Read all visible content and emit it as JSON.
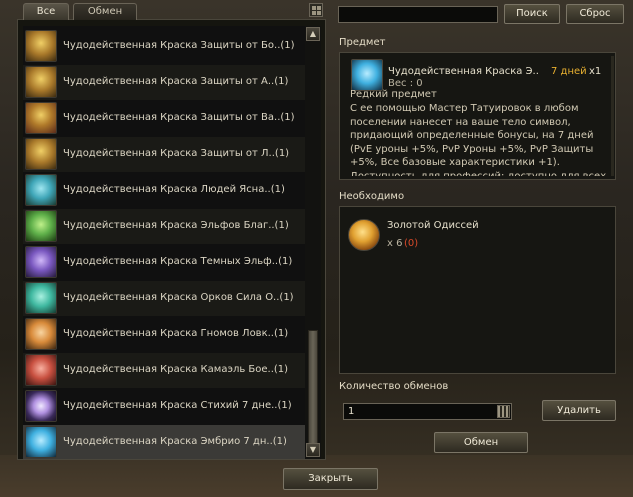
{
  "tabs": [
    {
      "label": "Все",
      "active": true
    },
    {
      "label": "Обмен",
      "active": false
    }
  ],
  "list": {
    "items": [
      {
        "label": "Чудодейственная Краска Защиты от Бо..(1)",
        "icon": "gold-dye-bottle-icon",
        "color": "#d8a43a"
      },
      {
        "label": "Чудодейственная Краска Защиты от А..(1)",
        "icon": "gold-dye-bottle-icon",
        "color": "#d8a43a"
      },
      {
        "label": "Чудодейственная Краска Защиты от Ва..(1)",
        "icon": "gold-dye-bottle-icon",
        "color": "#d8a43a"
      },
      {
        "label": "Чудодейственная Краска Защиты от Л..(1)",
        "icon": "gold-dye-bottle-icon",
        "color": "#d8a43a"
      },
      {
        "label": "Чудодейственная Краска Людей Ясна..(1)",
        "icon": "blue-dye-bottle-icon",
        "color": "#3fa6b8"
      },
      {
        "label": "Чудодейственная Краска Эльфов Благ..(1)",
        "icon": "green-dye-bottle-icon",
        "color": "#5fb04a"
      },
      {
        "label": "Чудодейственная Краска Темных Эльф..(1)",
        "icon": "purple-dye-bottle-icon",
        "color": "#7a58c0"
      },
      {
        "label": "Чудодейственная Краска Орков Сила О..(1)",
        "icon": "teal-dye-bottle-icon",
        "color": "#3fb8a0"
      },
      {
        "label": "Чудодейственная Краска Гномов Ловк..(1)",
        "icon": "orange-dye-bottle-icon",
        "color": "#d88a3a"
      },
      {
        "label": "Чудодейственная Краска Камаэль Бое..(1)",
        "icon": "red-dye-bottle-icon",
        "color": "#c85040"
      },
      {
        "label": "Чудодейственная Краска Стихий 7 дне..(1)",
        "icon": "violet-dye-orb-icon",
        "color": "#b090e0"
      },
      {
        "label": "Чудодейственная Краска Эмбрио 7 дн..(1)",
        "icon": "cyan-dye-bottle-icon",
        "color": "#3fb0e0"
      }
    ]
  },
  "search": {
    "value": "",
    "search_label": "Поиск",
    "reset_label": "Сброс"
  },
  "item": {
    "section_title": "Предмет",
    "name": "Чудодейственная Краска Э..",
    "duration": "7 дней",
    "count": "x1",
    "weight": "Вес : 0",
    "rarity": "Редкий предмет",
    "description": "С ее помощью Мастер Татуировок в любом поселении нанесет на ваше тело символ, придающий определенные бонусы, на 7 дней (PvE уроны +5%, PvP Уроны +5%, PvP Защиты +5%, Все базовые характеристики +1). Доступность для профессий: доступно для всех",
    "icon": "cyan-dye-bottle-icon"
  },
  "required": {
    "section_title": "Необходимо",
    "name": "Золотой Одиссей",
    "quantity": "x 6",
    "owned": "(0)",
    "icon": "gold-coin-icon"
  },
  "exchange": {
    "section_title": "Количество обменов",
    "quantity": "1",
    "delete_label": "Удалить",
    "exchange_label": "Обмен"
  },
  "close_label": "Закрыть",
  "colors": {
    "highlight": "#e8b030",
    "warning": "#d84a2a",
    "selected_row": "#3b3a37"
  }
}
